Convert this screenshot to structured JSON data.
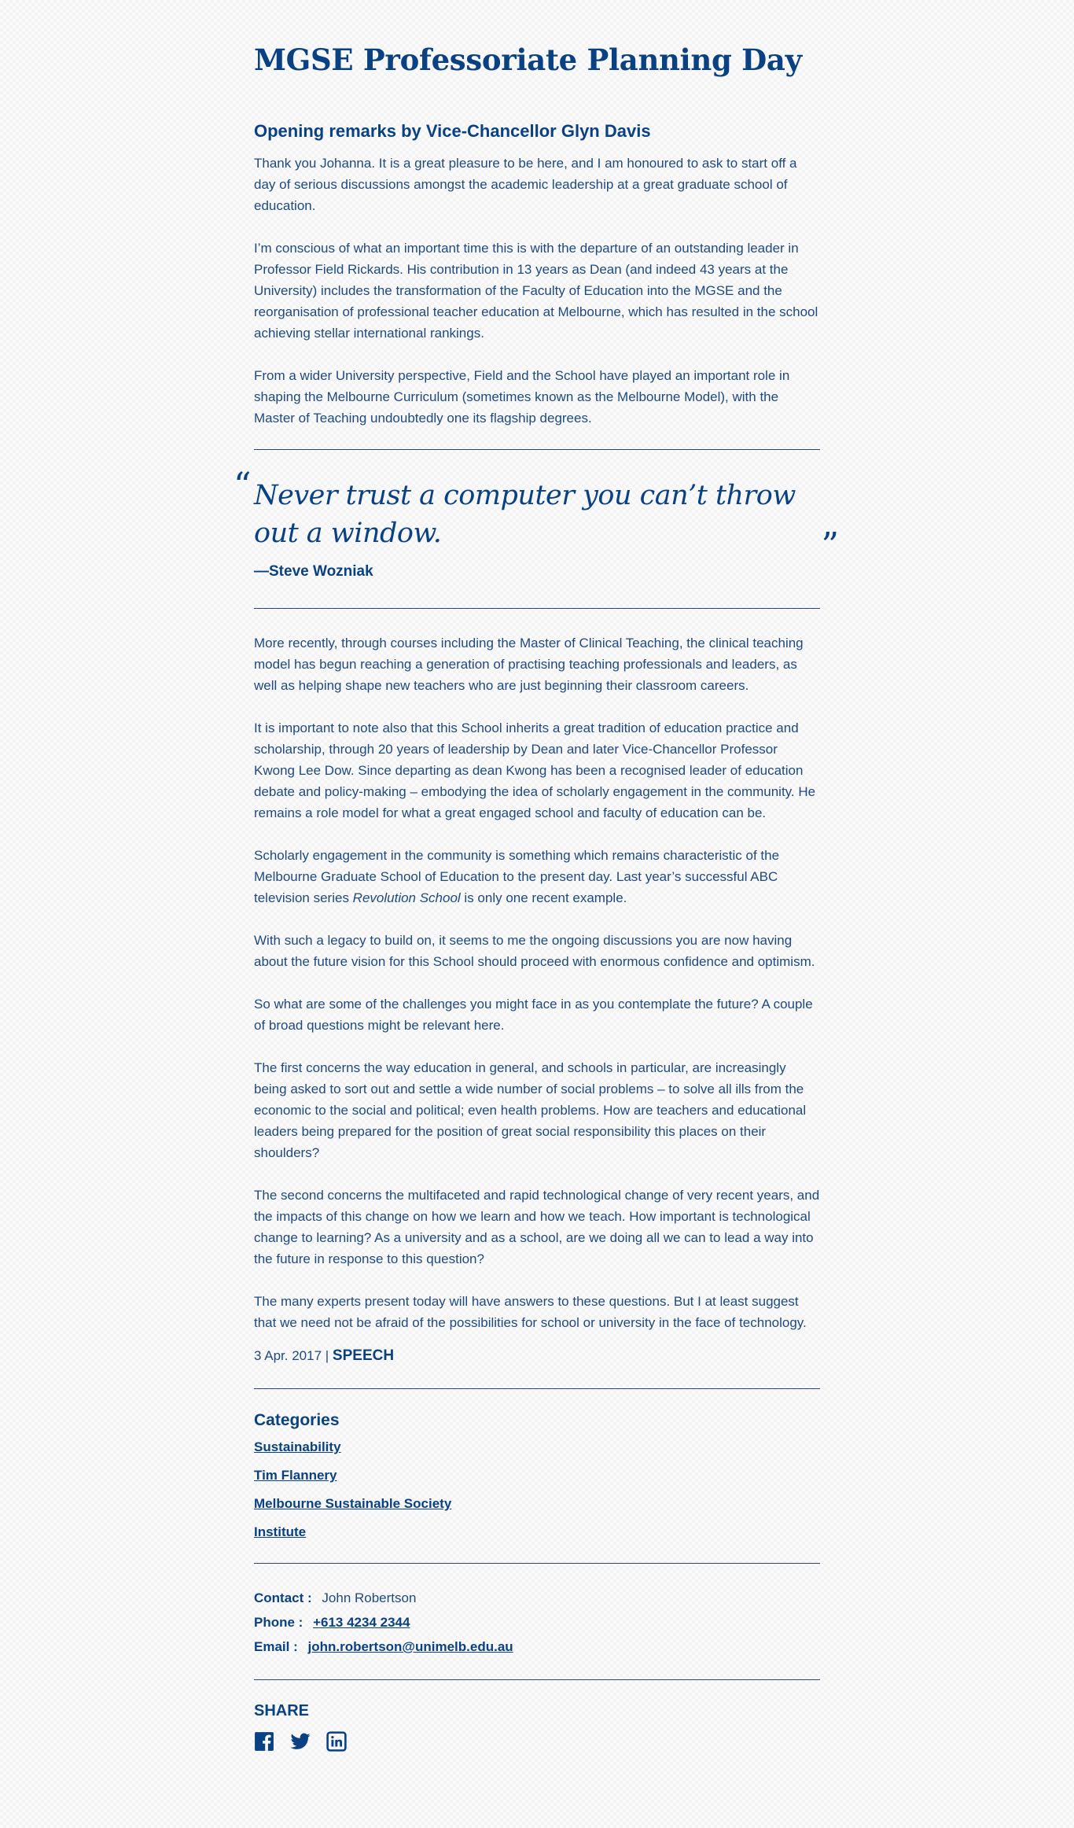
{
  "article": {
    "title": "MGSE Professoriate Planning Day",
    "subtitle": "Opening remarks by Vice-Chancellor Glyn Davis",
    "intro_paragraphs": [
      "Thank you Johanna. It is a great pleasure to be here, and I am honoured to ask to start off a day of serious discussions amongst the academic leadership at a great graduate school of education.",
      "I’m conscious of what an important time this is with the departure of an outstanding leader in Professor Field Rickards. His contribution in 13 years as Dean (and indeed 43 years at the University) includes the transformation of the Faculty of Education into the MGSE and the reorganisation of professional teacher education at Melbourne, which has resulted in the school achieving stellar international rankings.",
      "From a wider University perspective, Field and the School have played an important role in shaping the Melbourne Curriculum (sometimes known as the Melbourne Model), with the Master of Teaching undoubtedly one its flagship degrees."
    ],
    "quote": {
      "open_mark": "“",
      "text": "Never trust a computer you can’t throw out a window.",
      "close_mark": "”",
      "author": "—Steve Wozniak"
    },
    "body_paragraphs": [
      "More recently, through courses including the Master of Clinical Teaching, the clinical teaching model has begun reaching a generation of practising teaching professionals and leaders, as well as helping shape new teachers who are just beginning their classroom careers.",
      "It is important to note also that this School inherits a great tradition of education practice and scholarship, through 20 years of leadership by Dean and later Vice-Chancellor Professor Kwong Lee Dow. Since departing as dean Kwong has been a recognised leader of education debate and policy-making – embodying the idea of scholarly engagement in the community. He remains a role model for what a great engaged school and faculty of education can be."
    ],
    "revolution_paragraph": {
      "before": "Scholarly engagement in the community is something which remains characteristic of the Melbourne Graduate School of Education to the present day. Last year’s successful ABC television series ",
      "italic": "Revolution School",
      "after": " is only one recent example."
    },
    "closing_paragraphs": [
      "With such a legacy to build on, it seems to me the ongoing discussions you are now having about the future vision for this School should proceed with enormous confidence and optimism.",
      "So what are some of the challenges you might face in as you contemplate the future? A couple of broad questions might be relevant here.",
      "The first concerns the way education in general, and schools in particular, are increasingly being asked to sort out and settle a wide number of social problems – to solve all ills from the economic to the social and political; even health problems. How are teachers and educational leaders being prepared for the position of great social responsibility this places on their shoulders?",
      "The second concerns the multifaceted and rapid technological change of very recent years, and the impacts of this change on how we learn and how we teach. How important is technological change to learning? As a university and as a school, are we doing all we can to lead a way into the future in response to this question?",
      "The many experts present today will have answers to these questions. But I at least suggest that we need not be afraid of the possibilities for school or university in the face of technology."
    ],
    "date": "3 Apr. 2017",
    "separator": "|",
    "type": "SPEECH"
  },
  "categories": {
    "heading": "Categories",
    "items": [
      "Sustainability",
      "Tim Flannery",
      "Melbourne Sustainable Society",
      "Institute"
    ]
  },
  "contact": {
    "contact_label": "Contact :",
    "contact_name": "John Robertson",
    "phone_label": "Phone :",
    "phone": "+613 4234 2344",
    "email_label": "Email :",
    "email": "john.robertson@unimelb.edu.au"
  },
  "share": {
    "heading": "SHARE",
    "icons": [
      "facebook-icon",
      "twitter-icon",
      "linkedin-icon"
    ]
  },
  "colors": {
    "primary": "#094183",
    "text": "#1f4a7e"
  }
}
